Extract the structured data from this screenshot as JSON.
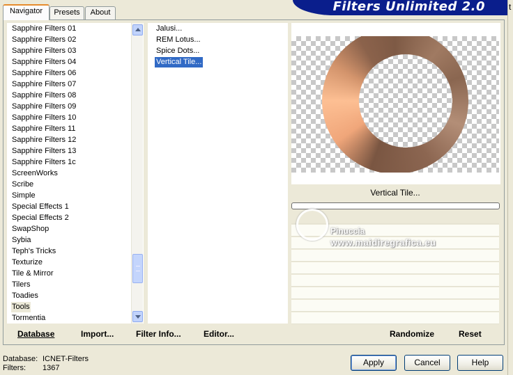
{
  "tabs": [
    {
      "label": "Navigator",
      "active": true
    },
    {
      "label": "Presets",
      "active": false
    },
    {
      "label": "About",
      "active": false
    }
  ],
  "title": "Filters Unlimited 2.0",
  "categories": [
    "Sapphire Filters 01",
    "Sapphire Filters 02",
    "Sapphire Filters 03",
    "Sapphire Filters 04",
    "Sapphire Filters 06",
    "Sapphire Filters 07",
    "Sapphire Filters 08",
    "Sapphire Filters 09",
    "Sapphire Filters 10",
    "Sapphire Filters 11",
    "Sapphire Filters 12",
    "Sapphire Filters 13",
    "Sapphire Filters 1c",
    "ScreenWorks",
    "Scribe",
    "Simple",
    "Special Effects 1",
    "Special Effects 2",
    "SwapShop",
    "Sybia",
    "Teph's Tricks",
    "Texturize",
    "Tile & Mirror",
    "Tilers",
    "Toadies",
    "Tools",
    "Tormentia"
  ],
  "selected_category": "Tools",
  "filters": [
    "Jalusi...",
    "REM Lotus...",
    "Spice Dots...",
    "Vertical Tile..."
  ],
  "selected_filter": "Vertical Tile...",
  "preview_filter_name": "Vertical Tile...",
  "watermark": {
    "name": "Pinuccia",
    "url": "www.maidiregrafica.eu"
  },
  "bottom_links": {
    "database": "Database",
    "import": "Import...",
    "filter_info": "Filter Info...",
    "editor": "Editor...",
    "randomize": "Randomize",
    "reset": "Reset"
  },
  "status": {
    "database_label": "Database:",
    "database_value": "ICNET-Filters",
    "filters_label": "Filters:",
    "filters_value": "1367"
  },
  "buttons": {
    "apply": "Apply",
    "cancel": "Cancel",
    "help": "Help"
  },
  "colors": {
    "selection": "#316ac5",
    "banner": "#0a1e8c",
    "dialog": "#ece9d8"
  }
}
